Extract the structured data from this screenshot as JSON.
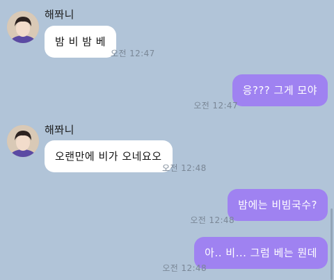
{
  "chat": {
    "messages": [
      {
        "direction": "incoming",
        "sender": "해쫘니",
        "avatar_icon": "profile-photo",
        "text": "밤 비 밤 베",
        "time": "오전 12:47"
      },
      {
        "direction": "outgoing",
        "text": "응??? 그게 모야",
        "time": "오전 12:47"
      },
      {
        "direction": "incoming",
        "sender": "해쫘니",
        "avatar_icon": "profile-photo",
        "text": "오랜만에 비가 오네요오",
        "time": "오전 12:48"
      },
      {
        "direction": "outgoing",
        "text": "밤에는 비빔국수?",
        "time": "오전 12:48"
      },
      {
        "direction": "outgoing",
        "text": "아.. 비... 그럼 베는 뭔데",
        "time": "오전 12:48"
      }
    ]
  },
  "colors": {
    "background": "#b1c4d8",
    "incoming_bubble": "#ffffff",
    "outgoing_bubble": "#9f82f1",
    "time_text": "#7a8796"
  }
}
